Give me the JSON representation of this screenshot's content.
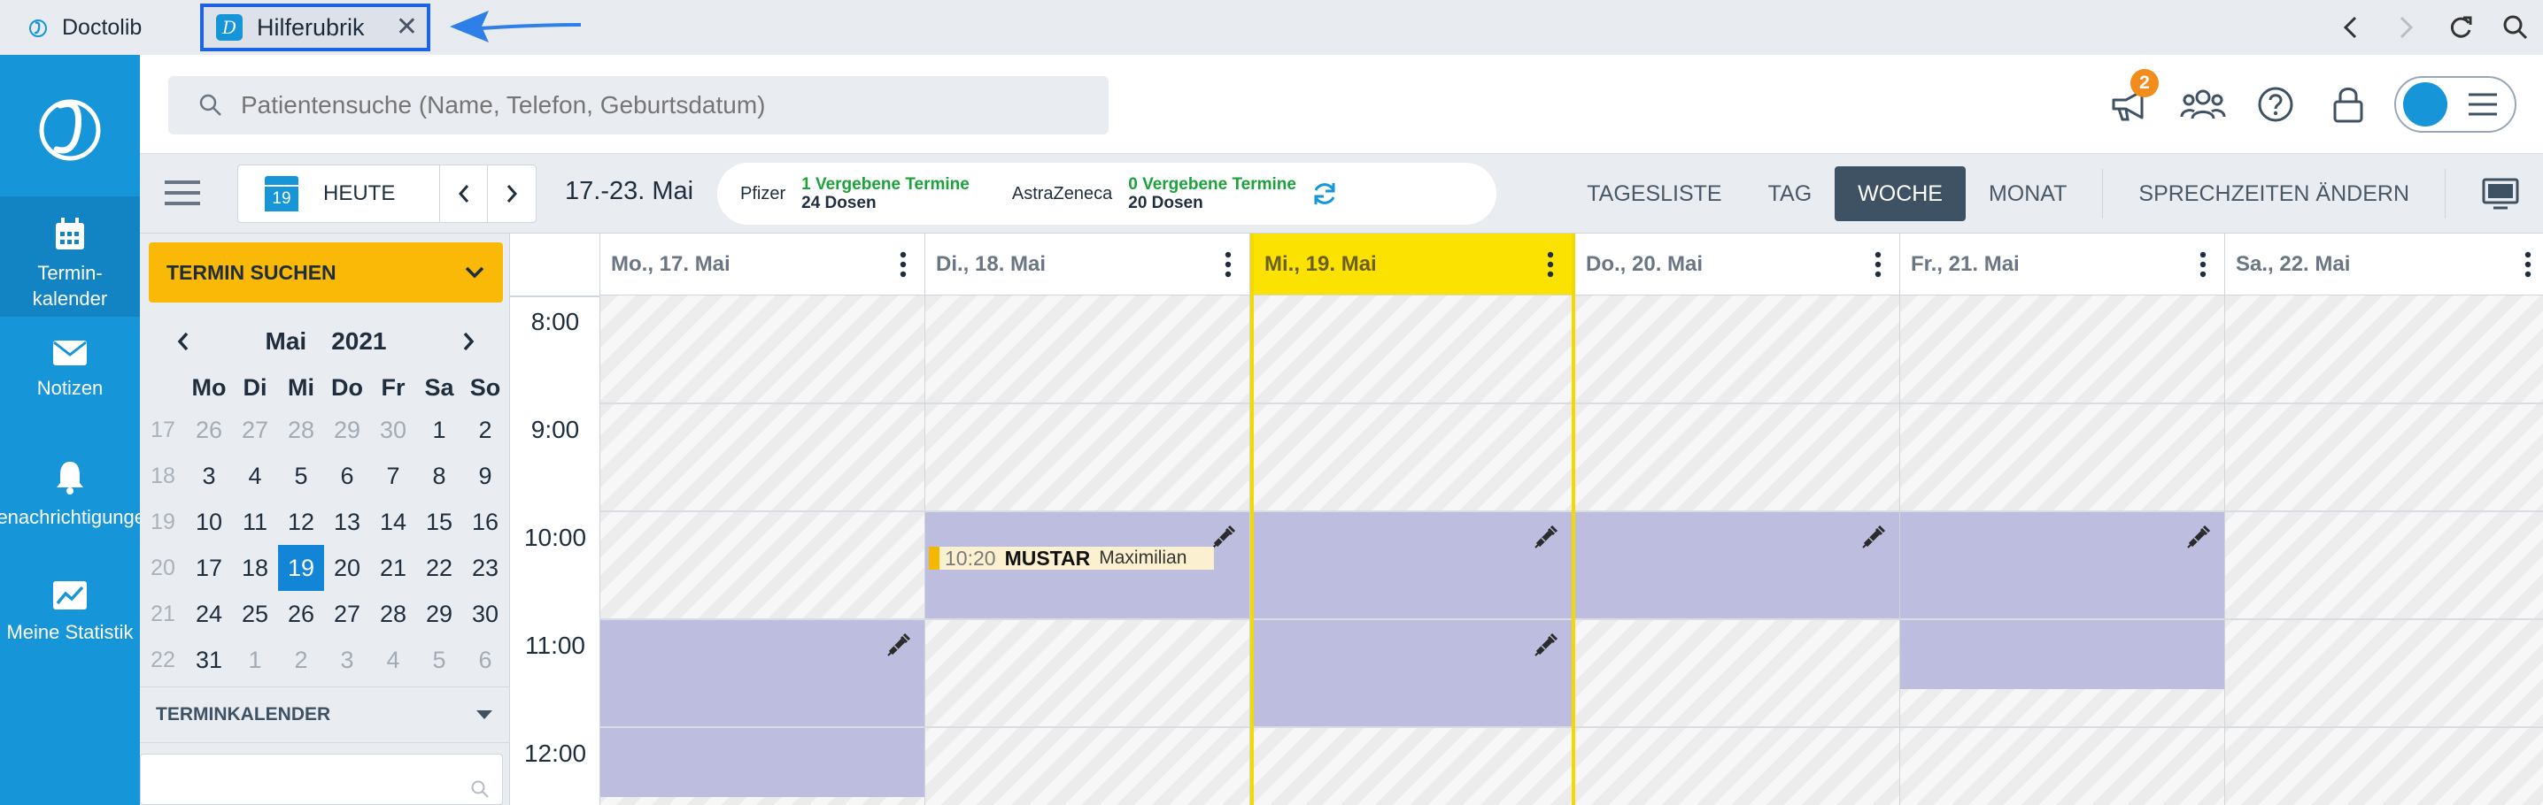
{
  "tabs": {
    "app_label": "Doctolib",
    "help_label": "Hilferubrik"
  },
  "sidebar": {
    "items": [
      {
        "label": "Termin-\nkalender",
        "icon": "calendar-icon"
      },
      {
        "label": "Notizen",
        "icon": "envelope-icon"
      },
      {
        "label": "Benachrichtigungen",
        "icon": "bell-icon"
      },
      {
        "label": "Meine Statistik",
        "icon": "chart-icon"
      }
    ]
  },
  "search": {
    "placeholder": "Patientensuche (Name, Telefon, Geburtsdatum)"
  },
  "topbar": {
    "notification_count": "2"
  },
  "toolbar": {
    "today_icon_day": "19",
    "today_label": "HEUTE",
    "date_range": "17.-23. Mai",
    "vaccines": [
      {
        "brand": "Pfizer",
        "given": "1 Vergebene Termine",
        "doses": "24 Dosen"
      },
      {
        "brand": "AstraZeneca",
        "given": "0 Vergebene Termine",
        "doses": "20 Dosen"
      }
    ],
    "views": [
      "TAGESLISTE",
      "TAG",
      "WOCHE",
      "MONAT"
    ],
    "active_view": "WOCHE",
    "change_hours": "SPRECHZEITEN ÄNDERN"
  },
  "left_panel": {
    "find_button": "TERMIN SUCHEN",
    "month": "Mai",
    "year": "2021",
    "weekdays": [
      "Mo",
      "Di",
      "Mi",
      "Do",
      "Fr",
      "Sa",
      "So"
    ],
    "weeks": [
      {
        "wk": "17",
        "days": [
          "26",
          "27",
          "28",
          "29",
          "30",
          "1",
          "2"
        ]
      },
      {
        "wk": "18",
        "days": [
          "3",
          "4",
          "5",
          "6",
          "7",
          "8",
          "9"
        ]
      },
      {
        "wk": "19",
        "days": [
          "10",
          "11",
          "12",
          "13",
          "14",
          "15",
          "16"
        ]
      },
      {
        "wk": "20",
        "days": [
          "17",
          "18",
          "19",
          "20",
          "21",
          "22",
          "23"
        ]
      },
      {
        "wk": "21",
        "days": [
          "24",
          "25",
          "26",
          "27",
          "28",
          "29",
          "30"
        ]
      },
      {
        "wk": "22",
        "days": [
          "31",
          "1",
          "2",
          "3",
          "4",
          "5",
          "6"
        ]
      }
    ],
    "selected_day": "19",
    "calendar_section": "TERMINKALENDER"
  },
  "calendar": {
    "hours": [
      "8:00",
      "9:00",
      "10:00",
      "11:00",
      "12:00"
    ],
    "days": [
      {
        "label": "Mo., 17. Mai"
      },
      {
        "label": "Di., 18. Mai"
      },
      {
        "label": "Mi., 19. Mai"
      },
      {
        "label": "Do., 20. Mai"
      },
      {
        "label": "Fr., 21. Mai"
      },
      {
        "label": "Sa., 22. Mai"
      }
    ],
    "today_index": 2,
    "appointment": {
      "time": "10:20",
      "last_name": "MUSTAR",
      "first_name": "Maximilian"
    }
  },
  "colors": {
    "brand_blue": "#1795d9",
    "today_yellow": "#fbe200",
    "available_slot": "#bcbddf",
    "find_button": "#f9b906",
    "highlight_border": "#1d63e6"
  }
}
